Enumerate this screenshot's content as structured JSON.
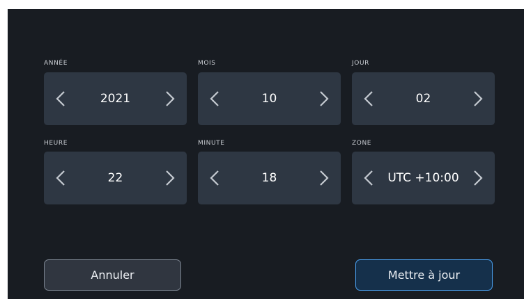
{
  "fields": [
    {
      "label": "ANNÉE",
      "value": "2021"
    },
    {
      "label": "MOIS",
      "value": "10"
    },
    {
      "label": "JOUR",
      "value": "02"
    },
    {
      "label": "HEURE",
      "value": "22"
    },
    {
      "label": "MINUTE",
      "value": "18"
    },
    {
      "label": "ZONE",
      "value": "UTC +10:00"
    }
  ],
  "buttons": {
    "cancel_label": "Annuler",
    "update_label": "Mettre à jour"
  },
  "colors": {
    "panel_bg": "#181c22",
    "stepper_bg": "#2e3743",
    "accent": "#4aa0f0",
    "label_text": "#c9cdd3",
    "value_text": "#ffffff"
  },
  "icons": {
    "decrement": "chevron-left-icon",
    "increment": "chevron-right-icon"
  }
}
